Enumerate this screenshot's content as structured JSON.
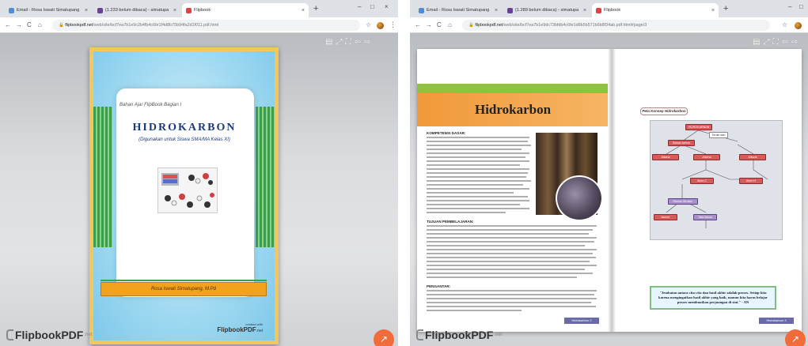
{
  "windows": [
    {
      "tabs": [
        {
          "label": "Email - Rosa Iswati Simatupang",
          "icon_color": "#4a90d9"
        },
        {
          "label": "(1.233 belum dibaca) - simatupa",
          "icon_color": "#6b3fa0"
        },
        {
          "label": "Flipbook",
          "icon_color": "#e04040"
        }
      ],
      "url_host": "flipbookpdf.net",
      "url_path": "/web/site/bcf7ea7b1e9c2b4fb4c6fe1f4d8b75b94fa2d1f011.pdf.html",
      "toolbar_glyphs": [
        "▤",
        "⤢",
        "⛶",
        "⇦",
        "⇨"
      ],
      "cover": {
        "series": "Bahan Ajar FlipBook Bagian I",
        "title": "HIDROKARBON",
        "subtitle": "(Digunakan untuk Siswa SMA/MA Kelas XI)",
        "author": "Rosa Iswati Simatupang, M.Pd",
        "brand": "FlipbookPDF",
        "brand_suffix": ".net",
        "brand_small": "created with"
      },
      "logo": {
        "text": "FlipbookPDF",
        "suffix": ".net"
      }
    },
    {
      "tabs": [
        {
          "label": "Email - Rosa Iswati Simatupang",
          "icon_color": "#4a90d9"
        },
        {
          "label": "(1.289 belum dibaca) - simatupa",
          "icon_color": "#6b3fa0"
        },
        {
          "label": "Flipbook",
          "icon_color": "#e04040"
        }
      ],
      "url_host": "flipbookpdf.net",
      "url_path": "/web/site/bcf7ea7b1e9dc73bfdb4c6fe1d8b5b571b6b8f34ab.pdf.html#page/3",
      "toolbar_glyphs": [
        "▤",
        "⤢",
        "⛶",
        "⇦",
        "⇨"
      ],
      "left_page": {
        "title": "Hidrokarbon",
        "section1": "KOMPETENSI DASAR:",
        "section2": "TUJUAN PEMBELAJARAN:",
        "section3": "PENGANTAR:",
        "page_number": "Hidrokarbon 2"
      },
      "right_page": {
        "map_label": "Peta Konsep Hidrokarbon",
        "nodes": [
          "HIDROKARBON",
          "Rantai karbon",
          "Terdiri dari",
          "Alkana",
          "Alkena",
          "Alkuna",
          "Atom C",
          "Atom H",
          "Rumus Struktur",
          "Isomer",
          "Tata Nama"
        ],
        "quote": "\"Jembatan antara cita-cita dan hasil akhir adalah proses. Setiap kita karena mengingatkan hasil akhir yang baik, namun kita harus belajar proses membuatkan perjuangan di sini.\" - AN",
        "page_number": "Hidrokarbon 3"
      },
      "logo": {
        "text": "FlipbookPDF",
        "suffix": ".net"
      }
    }
  ],
  "window_controls": {
    "minimize": "–",
    "maximize": "□",
    "close": "×"
  },
  "new_tab": "+"
}
